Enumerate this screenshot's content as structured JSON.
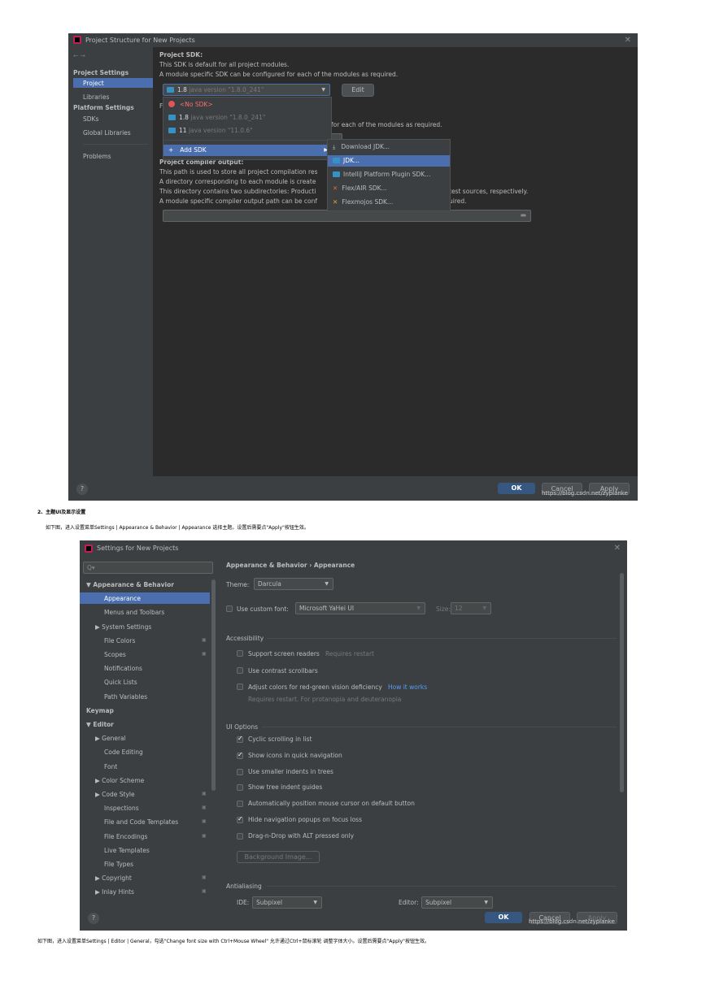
{
  "window1": {
    "title": "Project Structure for New Projects",
    "back_forward": "← →",
    "sidebar": {
      "project_settings": "Project Settings",
      "project": "Project",
      "libraries": "Libraries",
      "platform_settings": "Platform Settings",
      "sdks": "SDKs",
      "global_libraries": "Global Libraries",
      "problems": "Problems"
    },
    "project_sdk_title": "Project SDK:",
    "project_sdk_desc1": "This SDK is default for all project modules.",
    "project_sdk_desc2": "A module specific SDK can be configured for each of the modules as required.",
    "sdk_combo": {
      "version": "1.8",
      "detail": "java version \"1.8.0_241\""
    },
    "edit_button": "Edit",
    "hidden_line": "for each of the modules as required.",
    "sdk_dropdown": {
      "no_sdk": "<No SDK>",
      "items": [
        {
          "version": "1.8",
          "detail": "java version \"1.8.0_241\""
        },
        {
          "version": "11",
          "detail": "java version \"11.0.6\""
        }
      ],
      "add_sdk": "Add SDK"
    },
    "add_sdk_submenu": [
      "Download JDK...",
      "JDK...",
      "IntelliJ Platform Plugin SDK...",
      "Flex/AIR SDK...",
      "Flexmojos SDK..."
    ],
    "compiler_output_title": "Project compiler output:",
    "compiler_lines": [
      "This path is used to store all project compilation res",
      "A directory corresponding to each module is create",
      "This directory contains two subdirectories: Producti",
      "A module specific compiler output path can be conf"
    ],
    "compiler_tails": [
      "test sources, respectively.",
      "uired."
    ],
    "ok": "OK",
    "cancel": "Cancel",
    "apply": "Apply",
    "help": "?",
    "watermark": "https://blog.csdn.net/zyplanke"
  },
  "heading": "2、主题UI及显示设置",
  "caption1": "如下图，进入设置菜单Settings | Appearance & Behavior | Appearance 选择主题。设置后需要点\"Apply\"按钮生效。",
  "window2": {
    "title": "Settings for New Projects",
    "search_placeholder": "Q▾",
    "tree": [
      {
        "label": "▼ Appearance & Behavior",
        "bold": true,
        "indent": 0
      },
      {
        "label": "Appearance",
        "indent": 2,
        "selected": true
      },
      {
        "label": "Menus and Toolbars",
        "indent": 2
      },
      {
        "label": "▶ System Settings",
        "indent": 1
      },
      {
        "label": "File Colors",
        "indent": 2,
        "icon": true
      },
      {
        "label": "Scopes",
        "indent": 2,
        "icon": true
      },
      {
        "label": "Notifications",
        "indent": 2
      },
      {
        "label": "Quick Lists",
        "indent": 2
      },
      {
        "label": "Path Variables",
        "indent": 2
      },
      {
        "label": "Keymap",
        "bold": true,
        "indent": 0
      },
      {
        "label": "▼ Editor",
        "bold": true,
        "indent": 0
      },
      {
        "label": "▶ General",
        "indent": 1
      },
      {
        "label": "Code Editing",
        "indent": 2
      },
      {
        "label": "Font",
        "indent": 2
      },
      {
        "label": "▶ Color Scheme",
        "indent": 1
      },
      {
        "label": "▶ Code Style",
        "indent": 1,
        "icon": true
      },
      {
        "label": "Inspections",
        "indent": 2,
        "icon": true
      },
      {
        "label": "File and Code Templates",
        "indent": 2,
        "icon": true
      },
      {
        "label": "File Encodings",
        "indent": 2,
        "icon": true
      },
      {
        "label": "Live Templates",
        "indent": 2
      },
      {
        "label": "File Types",
        "indent": 2
      },
      {
        "label": "▶ Copyright",
        "indent": 1,
        "icon": true
      },
      {
        "label": "▶ Inlay Hints",
        "indent": 1,
        "icon": true
      }
    ],
    "breadcrumb": "Appearance & Behavior  ›  Appearance",
    "theme_label": "Theme:",
    "theme_value": "Darcula",
    "custom_font_label": "Use custom font:",
    "font_value": "Microsoft YaHei UI",
    "size_label": "Size:",
    "size_value": "12",
    "accessibility": "Accessibility",
    "support_screen_readers": "Support screen readers",
    "requires_restart": "Requires restart",
    "contrast_scrollbars": "Use contrast scrollbars",
    "adjust_colors": "Adjust colors for red-green vision deficiency",
    "how_it_works": "How it works",
    "adjust_note": "Requires restart. For protanopia and deuteranopia",
    "ui_options": "UI Options",
    "ui_checks": [
      {
        "label": "Cyclic scrolling in list",
        "checked": true
      },
      {
        "label": "Show icons in quick navigation",
        "checked": true
      },
      {
        "label": "Use smaller indents in trees",
        "checked": false
      },
      {
        "label": "Show tree indent guides",
        "checked": false
      },
      {
        "label": "Automatically position mouse cursor on default button",
        "checked": false
      },
      {
        "label": "Hide navigation popups on focus loss",
        "checked": true
      },
      {
        "label": "Drag-n-Drop with ALT pressed only",
        "checked": false
      }
    ],
    "background_image": "Background Image...",
    "antialiasing": "Antialiasing",
    "ide_label": "IDE:",
    "ide_value": "Subpixel",
    "editor_label": "Editor:",
    "editor_value": "Subpixel",
    "ok": "OK",
    "cancel": "Cancel",
    "apply": "Apply",
    "help": "?",
    "watermark": "https://blog.csdn.net/zyplanke"
  },
  "caption2": "如下图，进入设置菜单Settings | Editor | General，勾选\"Change font size with Ctrl+Mouse Wheel\" 允许通过Ctrl+鼠标滚轮 调整字体大小。设置后需要点\"Apply\"按钮生效。"
}
